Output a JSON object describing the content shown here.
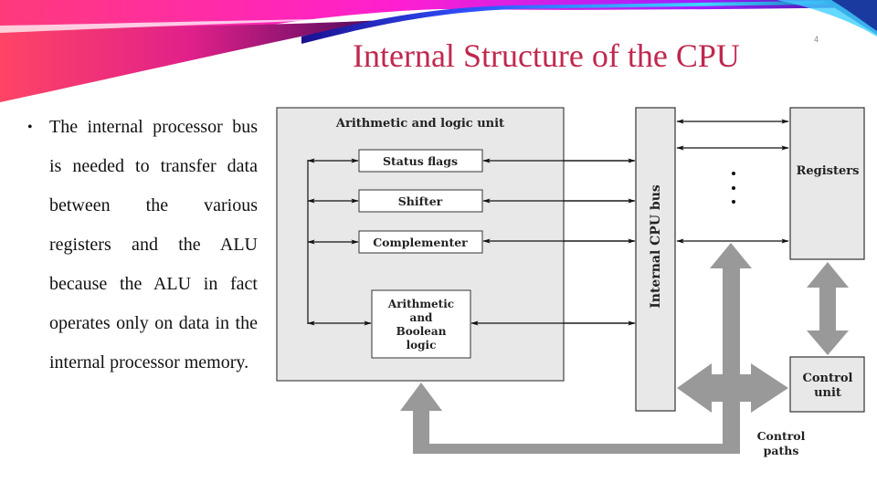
{
  "slide": {
    "title": "Internal Structure of the CPU",
    "slide_number": "4",
    "accent_color": "#c0284e"
  },
  "bullets": [
    {
      "icon": "bullet-dot",
      "text": "The internal processor bus is needed to transfer data between the various registers and the ALU because the ALU in fact operates only on data in the internal processor memory."
    }
  ],
  "diagram": {
    "alu": {
      "label": "Arithmetic and logic unit",
      "components": [
        {
          "label": "Status flags"
        },
        {
          "label": "Shifter"
        },
        {
          "label": "Complementer"
        },
        {
          "label_lines": [
            "Arithmetic",
            "and",
            "Boolean",
            "logic"
          ]
        }
      ]
    },
    "bus": {
      "label": "Internal CPU bus"
    },
    "registers": {
      "label": "Registers",
      "ellipsis": "⋮"
    },
    "control_unit": {
      "label_lines": [
        "Control",
        "unit"
      ]
    },
    "control_paths": {
      "label_lines": [
        "Control",
        "paths"
      ]
    },
    "colors": {
      "box_fill": "#e8e8e8",
      "inner_box_fill": "#ffffff",
      "control_path": "#999999",
      "line": "#111111"
    }
  }
}
